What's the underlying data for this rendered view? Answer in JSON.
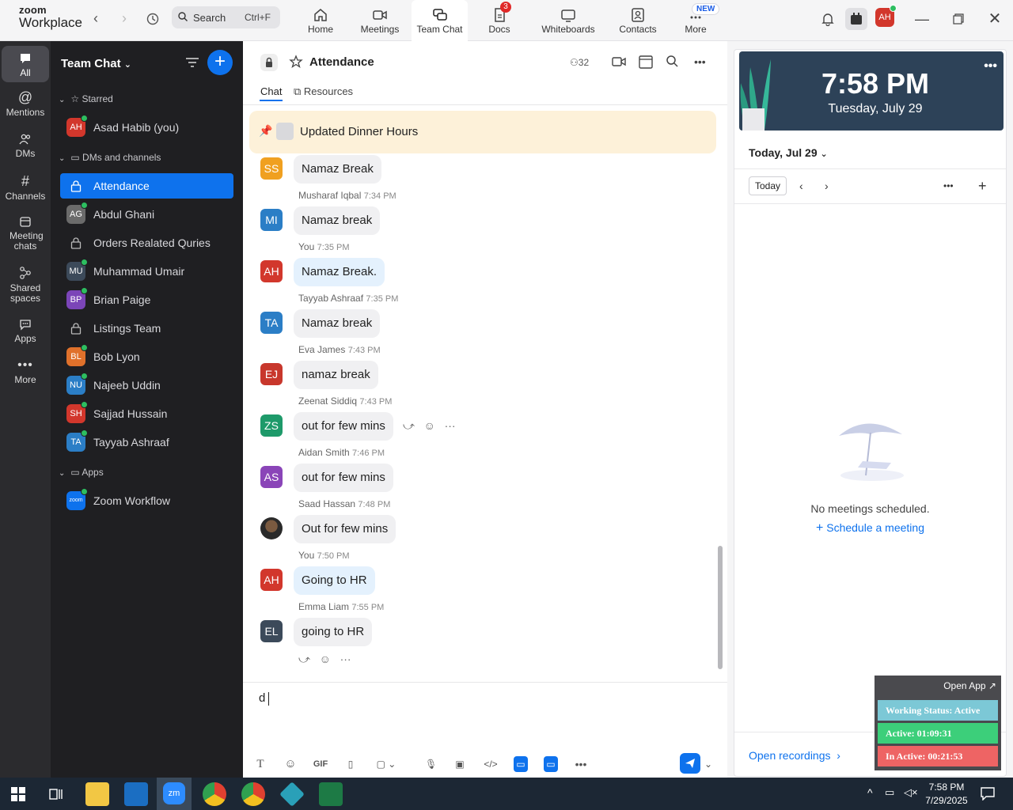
{
  "app": {
    "brand_top": "zoom",
    "brand_bottom": "Workplace"
  },
  "search": {
    "label": "Search",
    "shortcut": "Ctrl+F"
  },
  "nav": [
    {
      "label": "Home"
    },
    {
      "label": "Meetings"
    },
    {
      "label": "Team Chat"
    },
    {
      "label": "Docs",
      "badge": "3"
    },
    {
      "label": "Whiteboards"
    },
    {
      "label": "Contacts"
    },
    {
      "label": "More",
      "badge": "NEW"
    }
  ],
  "user_avatar": "AH",
  "rail": [
    {
      "label": "All"
    },
    {
      "label": "Mentions"
    },
    {
      "label": "DMs"
    },
    {
      "label": "Channels"
    },
    {
      "label": "Meeting chats"
    },
    {
      "label": "Shared spaces"
    },
    {
      "label": "Apps"
    },
    {
      "label": "More"
    }
  ],
  "sidebar": {
    "title": "Team Chat",
    "starred_label": "Starred",
    "starred": [
      {
        "initials": "AH",
        "name": "Asad Habib (you)",
        "color": "#d2372c"
      }
    ],
    "dms_label": "DMs and channels",
    "dms": [
      {
        "name": "Attendance",
        "type": "lock",
        "active": true
      },
      {
        "initials": "AG",
        "name": "Abdul Ghani",
        "color": "#6b6b6b",
        "type": "person"
      },
      {
        "name": "Orders Realated Quries",
        "type": "lock"
      },
      {
        "initials": "MU",
        "name": "Muhammad Umair",
        "color": "#3c4a5a",
        "type": "person"
      },
      {
        "initials": "BP",
        "name": "Brian Paige",
        "color": "#7b45b8",
        "type": "person"
      },
      {
        "name": "Listings Team",
        "type": "lock"
      },
      {
        "initials": "BL",
        "name": "Bob Lyon",
        "color": "#e0712b",
        "type": "person"
      },
      {
        "initials": "NU",
        "name": "Najeeb Uddin",
        "color": "#2b7ec6",
        "type": "person"
      },
      {
        "initials": "SH",
        "name": "Sajjad Hussain",
        "color": "#d2372c",
        "type": "person"
      },
      {
        "initials": "TA",
        "name": "Tayyab Ashraaf",
        "color": "#2b7ec6",
        "type": "person"
      }
    ],
    "apps_label": "Apps",
    "apps": [
      {
        "initials": "zoom",
        "name": "Zoom Workflow",
        "color": "#0e72ed"
      }
    ]
  },
  "channel": {
    "title": "Attendance",
    "members": "32",
    "tabs": [
      {
        "label": "Chat"
      },
      {
        "label": "Resources"
      }
    ],
    "pinned": "Updated Dinner Hours",
    "messages": [
      {
        "initials": "SS",
        "color": "#f0a020",
        "sender": "",
        "time": "",
        "text": "Namaz Break",
        "mine": false
      },
      {
        "initials": "MI",
        "color": "#2b7ec6",
        "sender": "Musharaf Iqbal",
        "time": "7:34 PM",
        "text": "Namaz break",
        "mine": false
      },
      {
        "initials": "AH",
        "color": "#d2372c",
        "sender": "You",
        "time": "7:35 PM",
        "text": "Namaz Break.",
        "mine": true
      },
      {
        "initials": "TA",
        "color": "#2b7ec6",
        "sender": "Tayyab Ashraaf",
        "time": "7:35 PM",
        "text": "Namaz break",
        "mine": false
      },
      {
        "initials": "EJ",
        "color": "#c8372c",
        "sender": "Eva James",
        "time": "7:43 PM",
        "text": "namaz break",
        "mine": false
      },
      {
        "initials": "ZS",
        "color": "#1e9a6a",
        "sender": "Zeenat Siddiq",
        "time": "7:43 PM",
        "text": "out for few mins",
        "mine": false
      },
      {
        "initials": "AS",
        "color": "#8a45b8",
        "sender": "Aidan Smith",
        "time": "7:46 PM",
        "text": "out for few mins",
        "mine": false
      },
      {
        "initials": "",
        "color": "#3a3a3a",
        "sender": "Saad Hassan",
        "time": "7:48 PM",
        "text": "Out for few mins",
        "mine": false
      },
      {
        "initials": "AH",
        "color": "#d2372c",
        "sender": "You",
        "time": "7:50 PM",
        "text": "Going to HR",
        "mine": true
      },
      {
        "initials": "EL",
        "color": "#3c4a5a",
        "sender": "Emma Liam",
        "time": "7:55 PM",
        "text": "going to HR",
        "mine": false
      }
    ],
    "compose_value": "d",
    "toolbar": {
      "gif": "GIF"
    }
  },
  "calendar": {
    "time": "7:58 PM",
    "date": "Tuesday, July 29",
    "today_header": "Today, Jul 29",
    "today_button": "Today",
    "empty": "No meetings scheduled.",
    "schedule": "Schedule a meeting",
    "recordings": "Open recordings"
  },
  "work_status": {
    "open_app": "Open App ↗",
    "status": "Working Status: Active",
    "active": "Active: 01:09:31",
    "inactive": "In Active: 00:21:53"
  },
  "taskbar": {
    "time": "7:58 PM",
    "date": "7/29/2025"
  }
}
